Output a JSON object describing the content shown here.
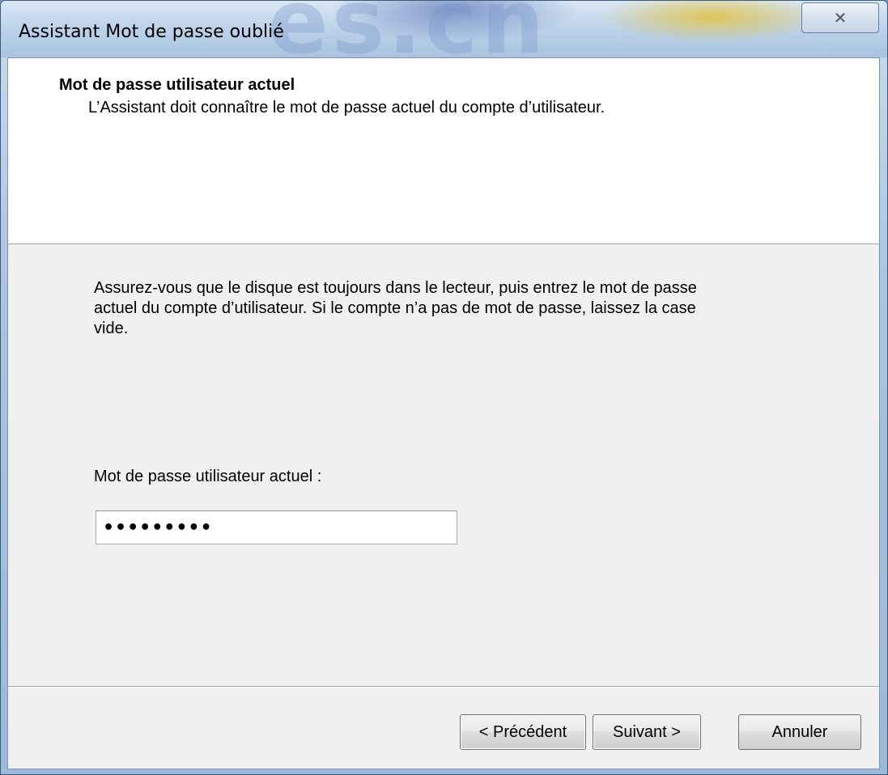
{
  "window": {
    "title": "Assistant Mot de passe oublié",
    "watermark": "es.cn",
    "close_icon": "close-icon",
    "close_glyph": "✕"
  },
  "header": {
    "title": "Mot de passe utilisateur actuel",
    "subtitle": "L’Assistant doit connaître le mot de passe actuel du compte d’utilisateur."
  },
  "body": {
    "instructions": "Assurez-vous que le disque est toujours dans le lecteur, puis entrez le mot de passe actuel du compte d’utilisateur. Si le compte n’a pas de mot de passe, laissez la case vide.",
    "password_label": "Mot de passe utilisateur actuel :",
    "password_value": "•••••••••"
  },
  "buttons": {
    "previous": "< Précédent",
    "next": "Suivant >",
    "cancel": "Annuler"
  },
  "colors": {
    "client_background": "#f0f0f0",
    "header_background": "#ffffff",
    "titlebar_accent": "#a9c4e0"
  }
}
